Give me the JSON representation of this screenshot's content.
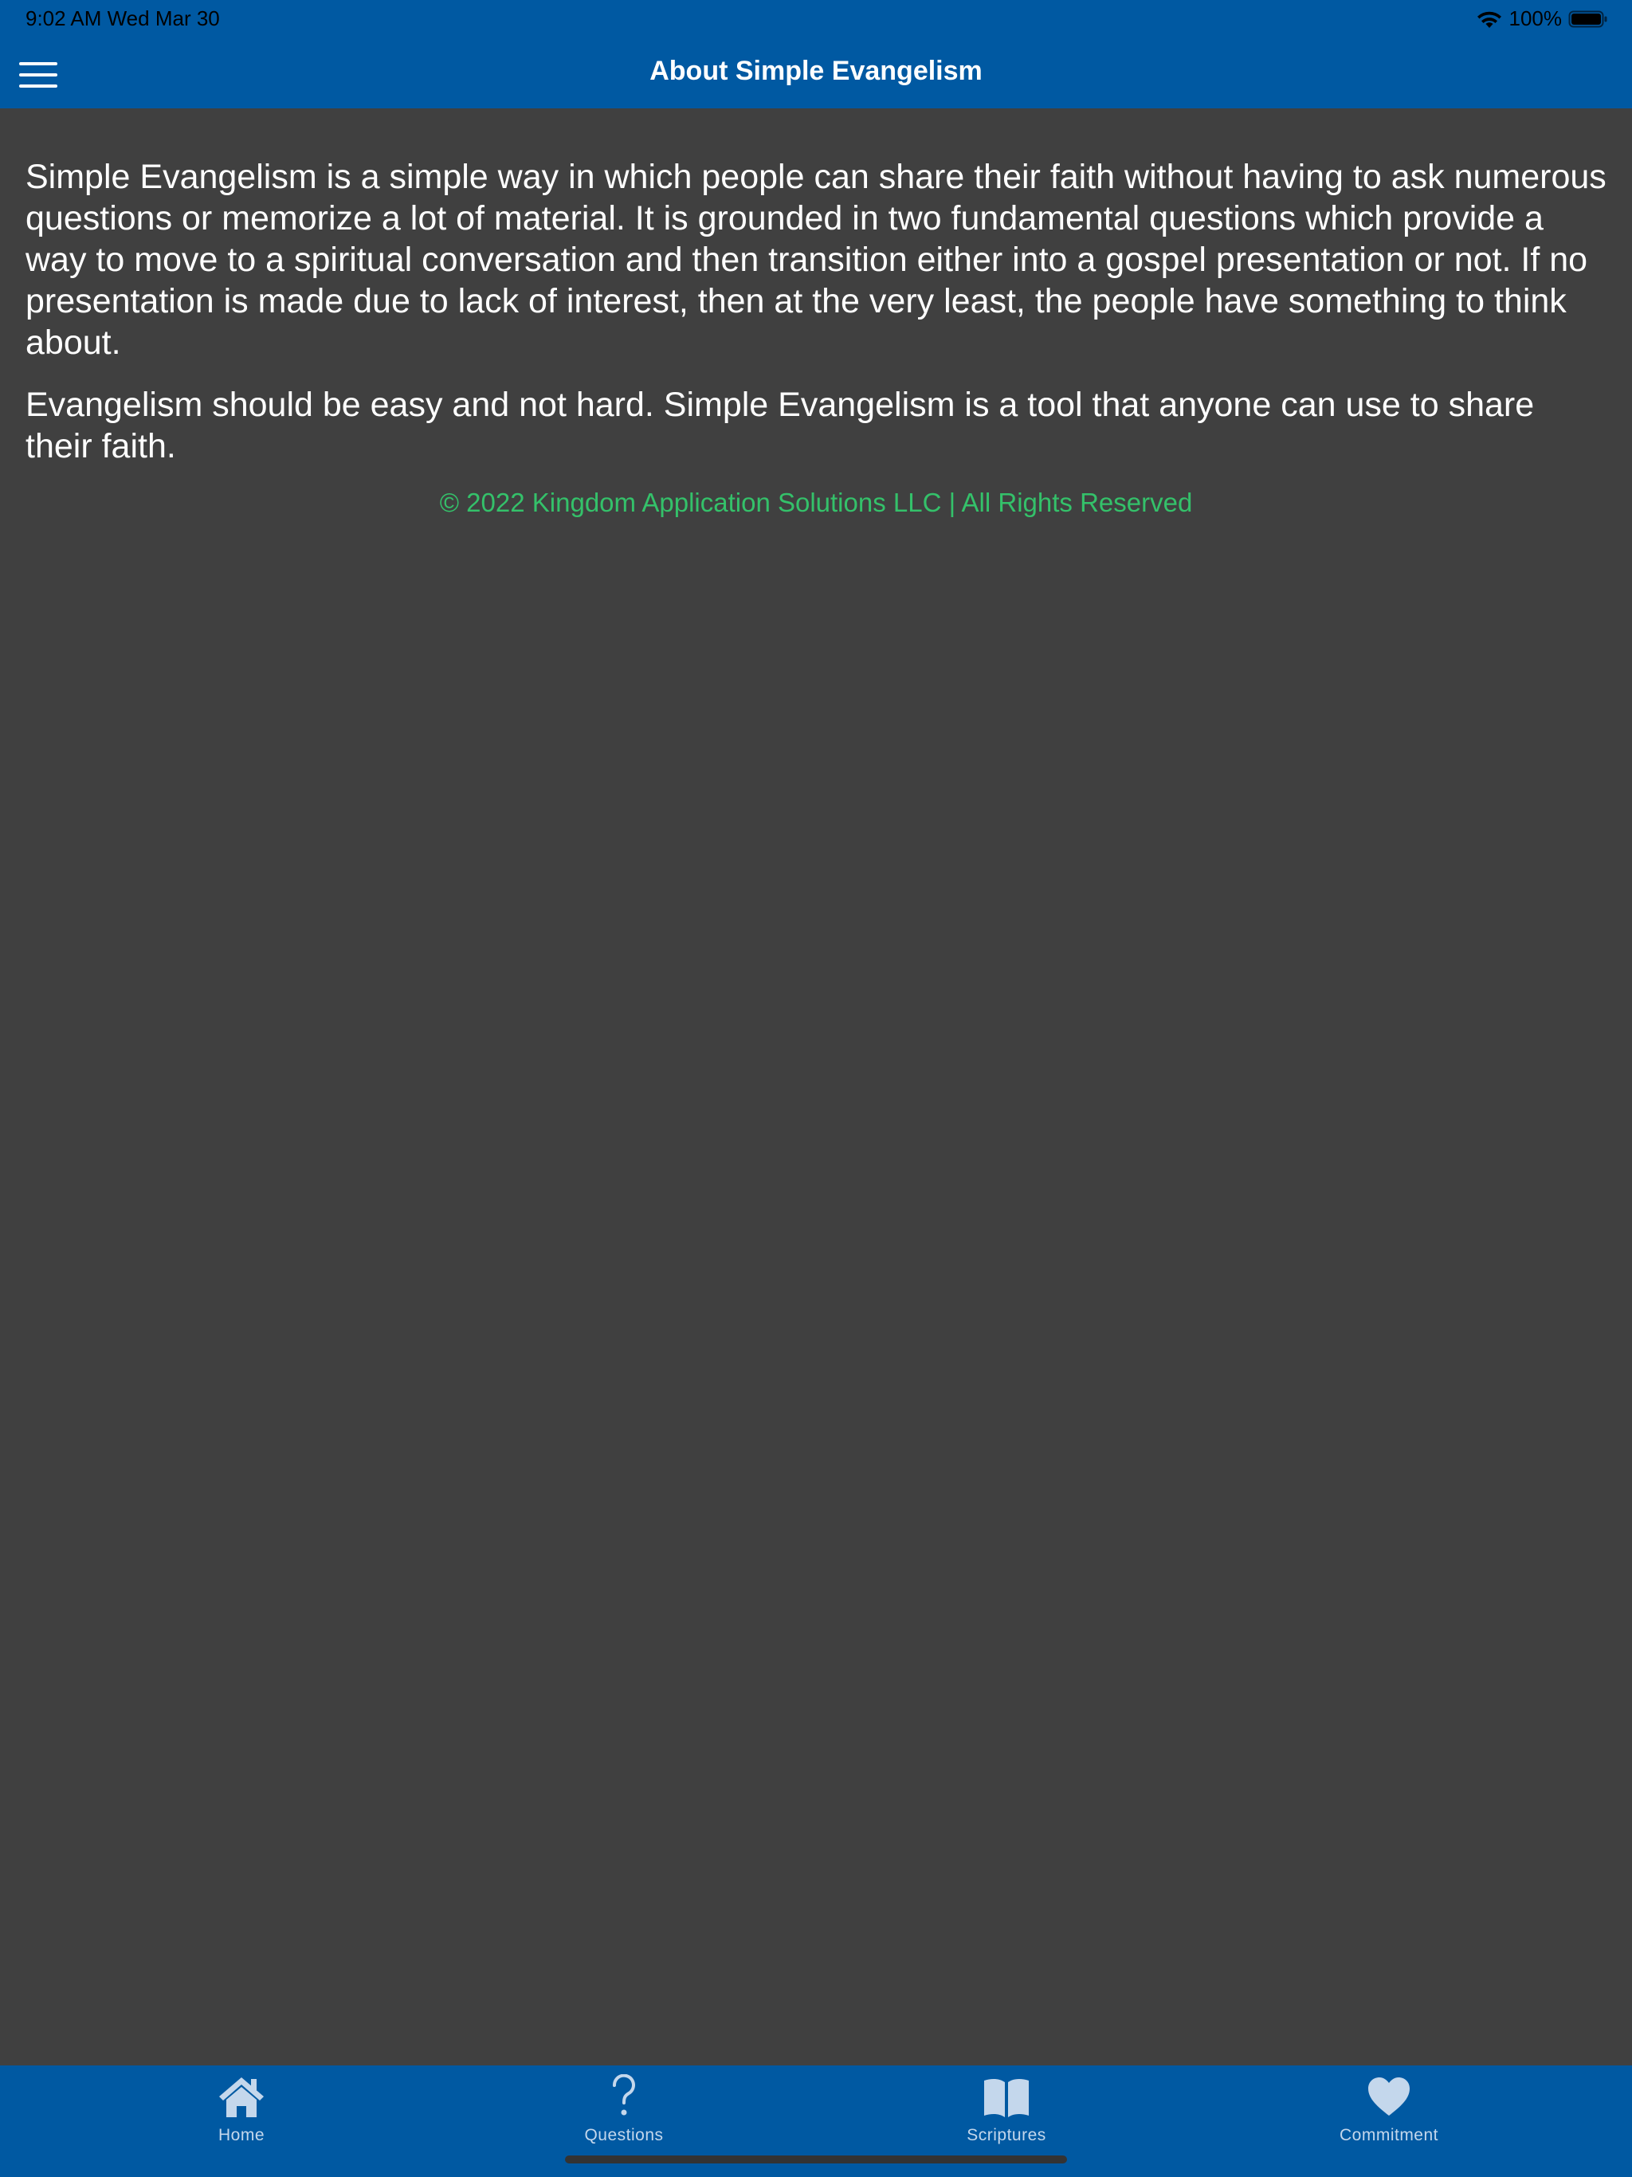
{
  "status_bar": {
    "time": "9:02 AM   Wed Mar 30",
    "battery": "100%"
  },
  "header": {
    "title": "About Simple Evangelism",
    "menu_icon": "hamburger-menu-icon"
  },
  "content": {
    "paragraphs": [
      "Simple Evangelism is a simple way in which people can share their faith without having to ask numerous questions or memorize a lot of material. It is grounded in two fundamental questions which provide a way to move to a spiritual conversation and then transition either into a gospel presentation or not. If no presentation is made due to lack of interest, then at the very least, the people have something to think about.",
      "Evangelism should be easy and not hard. Simple Evangelism is a tool that anyone can use to share their faith."
    ],
    "copyright": "© 2022 Kingdom Application Solutions LLC | All Rights Reserved"
  },
  "tabs": [
    {
      "label": "Home",
      "icon": "home-icon"
    },
    {
      "label": "Questions",
      "icon": "question-mark-icon"
    },
    {
      "label": "Scriptures",
      "icon": "open-book-icon"
    },
    {
      "label": "Commitment",
      "icon": "heart-icon"
    }
  ],
  "colors": {
    "bar_blue": "#0059A2",
    "background": "#404040",
    "copyright_green": "#34C16A",
    "tab_label": "#C4D7EC"
  }
}
